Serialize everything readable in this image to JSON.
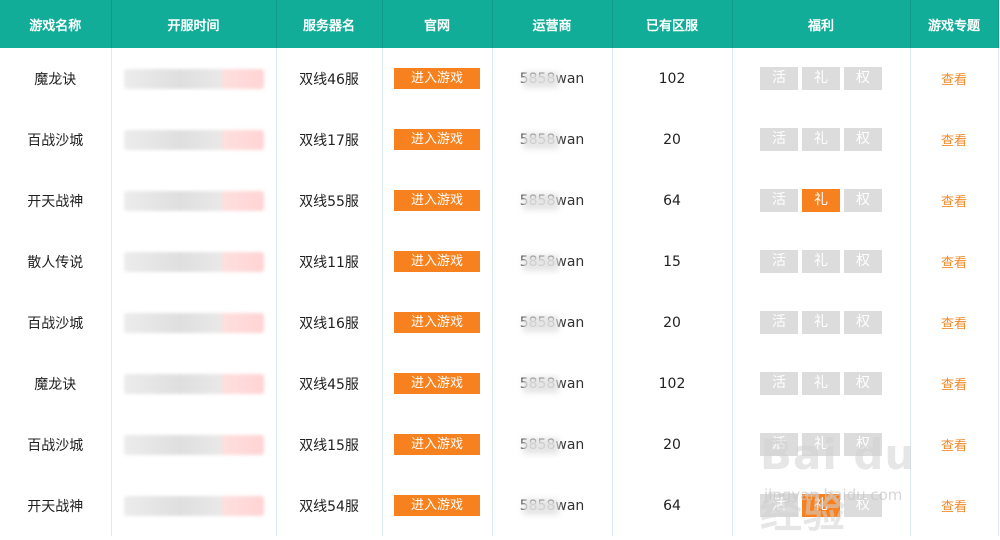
{
  "headers": [
    "游戏名称",
    "开服时间",
    "服务器名",
    "官网",
    "运营商",
    "已有区服",
    "福利",
    "游戏专题"
  ],
  "enter_label": "进入游戏",
  "view_label": "查看",
  "perks": [
    "活",
    "礼",
    "权"
  ],
  "rows": [
    {
      "name": "魔龙诀",
      "server": "双线46服",
      "operator": "5858wan",
      "count": "102",
      "gift_active": false
    },
    {
      "name": "百战沙城",
      "server": "双线17服",
      "operator": "5858wan",
      "count": "20",
      "gift_active": false
    },
    {
      "name": "开天战神",
      "server": "双线55服",
      "operator": "5858wan",
      "count": "64",
      "gift_active": true
    },
    {
      "name": "散人传说",
      "server": "双线11服",
      "operator": "5858wan",
      "count": "15",
      "gift_active": false
    },
    {
      "name": "百战沙城",
      "server": "双线16服",
      "operator": "5858wan",
      "count": "20",
      "gift_active": false
    },
    {
      "name": "魔龙诀",
      "server": "双线45服",
      "operator": "5858wan",
      "count": "102",
      "gift_active": false
    },
    {
      "name": "百战沙城",
      "server": "双线15服",
      "operator": "5858wan",
      "count": "20",
      "gift_active": false
    },
    {
      "name": "开天战神",
      "server": "双线54服",
      "operator": "5858wan",
      "count": "64",
      "gift_active": true
    }
  ],
  "watermark": {
    "main": "Bai du 经验",
    "sub": "jingyan.baidu.com"
  },
  "colors": {
    "header_bg": "#12ad98",
    "accent_orange": "#f7811e",
    "name_teal": "#199a8a",
    "perk_gray": "#dcdcdc",
    "divider": "#dcebf3"
  }
}
